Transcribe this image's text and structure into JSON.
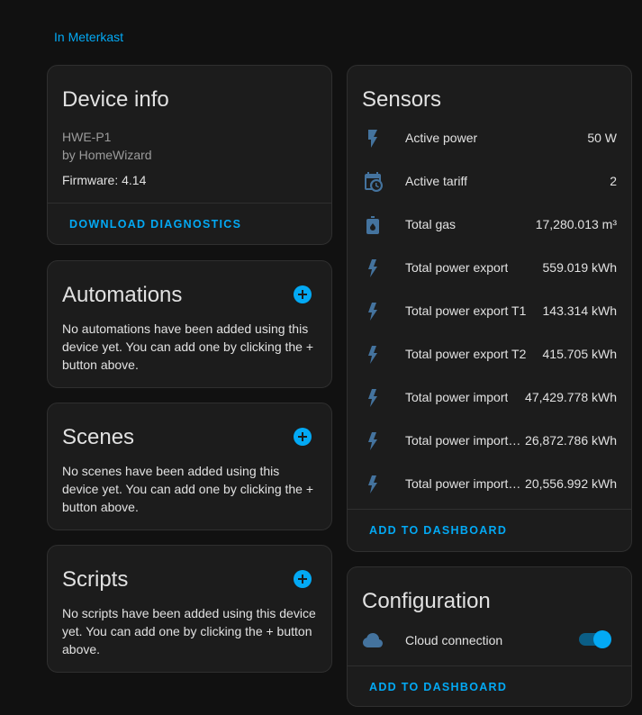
{
  "breadcrumb": "In Meterkast",
  "device_info": {
    "title": "Device info",
    "model": "HWE-P1",
    "manufacturer": "by HomeWizard",
    "firmware": "Firmware: 4.14",
    "action": "DOWNLOAD DIAGNOSTICS"
  },
  "automations": {
    "title": "Automations",
    "empty": "No automations have been added using this device yet. You can add one by clicking the + button above."
  },
  "scenes": {
    "title": "Scenes",
    "empty": "No scenes have been added using this device yet. You can add one by clicking the + button above."
  },
  "scripts": {
    "title": "Scripts",
    "empty": "No scripts have been added using this device yet. You can add one by clicking the + button above."
  },
  "sensors": {
    "title": "Sensors",
    "items": [
      {
        "icon": "flash-icon",
        "name": "Active power",
        "value": "50 W"
      },
      {
        "icon": "calendar-clock-icon",
        "name": "Active tariff",
        "value": "2"
      },
      {
        "icon": "gas-meter-icon",
        "name": "Total gas",
        "value": "17,280.013 m³"
      },
      {
        "icon": "flash-icon",
        "name": "Total power export",
        "value": "559.019 kWh"
      },
      {
        "icon": "flash-icon",
        "name": "Total power export T1",
        "value": "143.314 kWh"
      },
      {
        "icon": "flash-icon",
        "name": "Total power export T2",
        "value": "415.705 kWh"
      },
      {
        "icon": "flash-icon",
        "name": "Total power import",
        "value": "47,429.778 kWh"
      },
      {
        "icon": "flash-icon",
        "name": "Total power import…",
        "value": "26,872.786 kWh"
      },
      {
        "icon": "flash-icon",
        "name": "Total power import…",
        "value": "20,556.992 kWh"
      }
    ],
    "action": "ADD TO DASHBOARD"
  },
  "configuration": {
    "title": "Configuration",
    "items": [
      {
        "icon": "cloud-icon",
        "name": "Cloud connection",
        "state": "on"
      }
    ],
    "action": "ADD TO DASHBOARD"
  },
  "colors": {
    "accent": "#03a9f4",
    "icon": "#44739e",
    "background": "#111111",
    "card": "#1c1c1c"
  }
}
